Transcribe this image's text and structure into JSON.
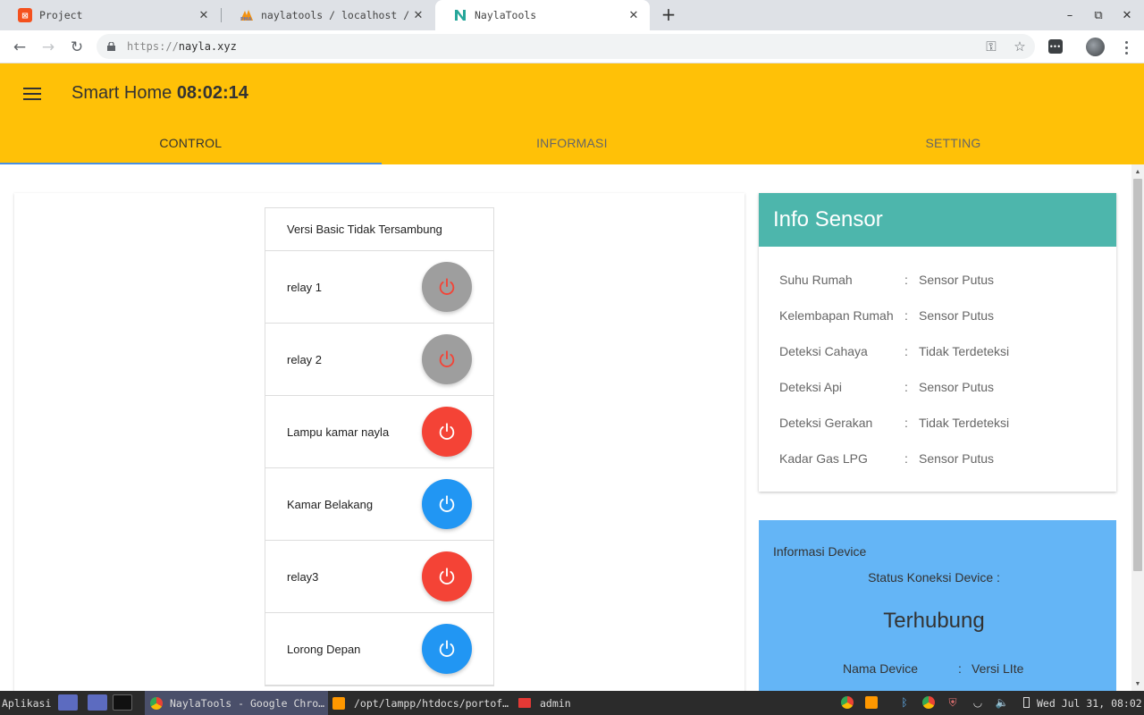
{
  "browser": {
    "tabs": [
      {
        "title": "Project",
        "icon": "xampp-icon",
        "color": "#f4511e",
        "active": false
      },
      {
        "title": "naylatools / localhost /",
        "icon": "phpmyadmin-icon",
        "color": "#f29111",
        "active": false
      },
      {
        "title": "NaylaTools",
        "icon": "naylatools-icon",
        "color": "#26a69a",
        "active": true
      }
    ],
    "url_scheme": "https://",
    "url_host": "nayla.xyz"
  },
  "app": {
    "title": "Smart Home",
    "clock": "08:02:14",
    "header_color": "#ffc107",
    "tabs": [
      "CONTROL",
      "INFORMASI",
      "SETTING"
    ],
    "active_tab": "CONTROL"
  },
  "relays": {
    "header": "Versi Basic Tidak Tersambung",
    "items": [
      {
        "label": "relay 1",
        "state": "disabled",
        "button_color": "#9e9e9e",
        "icon_color": "#f44336"
      },
      {
        "label": "relay 2",
        "state": "disabled",
        "button_color": "#9e9e9e",
        "icon_color": "#f44336"
      },
      {
        "label": "Lampu kamar nayla",
        "state": "off",
        "button_color": "#f44336",
        "icon_color": "#ffffff"
      },
      {
        "label": "Kamar Belakang",
        "state": "on",
        "button_color": "#2196f3",
        "icon_color": "#ffffff"
      },
      {
        "label": "relay3",
        "state": "off",
        "button_color": "#f44336",
        "icon_color": "#ffffff"
      },
      {
        "label": "Lorong Depan",
        "state": "on",
        "button_color": "#2196f3",
        "icon_color": "#ffffff"
      }
    ]
  },
  "sensor": {
    "title": "Info Sensor",
    "header_color": "#4db6ac",
    "rows": [
      {
        "label": "Suhu Rumah",
        "value": "Sensor Putus"
      },
      {
        "label": "Kelembapan Rumah",
        "value": "Sensor Putus"
      },
      {
        "label": "Deteksi Cahaya",
        "value": "Tidak Terdeteksi"
      },
      {
        "label": "Deteksi Api",
        "value": "Sensor Putus"
      },
      {
        "label": "Deteksi Gerakan",
        "value": "Tidak Terdeteksi"
      },
      {
        "label": "Kadar Gas LPG",
        "value": "Sensor Putus"
      }
    ]
  },
  "device": {
    "title": "Informasi Device",
    "status_label": "Status Koneksi Device :",
    "status": "Terhubung",
    "name_label": "Nama Device",
    "name_value": "Versi LIte",
    "card_color": "#64b5f6"
  },
  "taskbar": {
    "menu": "Aplikasi",
    "windows": [
      {
        "title": "NaylaTools - Google Chro…",
        "active": true
      },
      {
        "title": "/opt/lampp/htdocs/portof…",
        "active": false
      },
      {
        "title": "admin",
        "active": false
      }
    ],
    "clock": "Wed Jul 31, 08:02"
  }
}
